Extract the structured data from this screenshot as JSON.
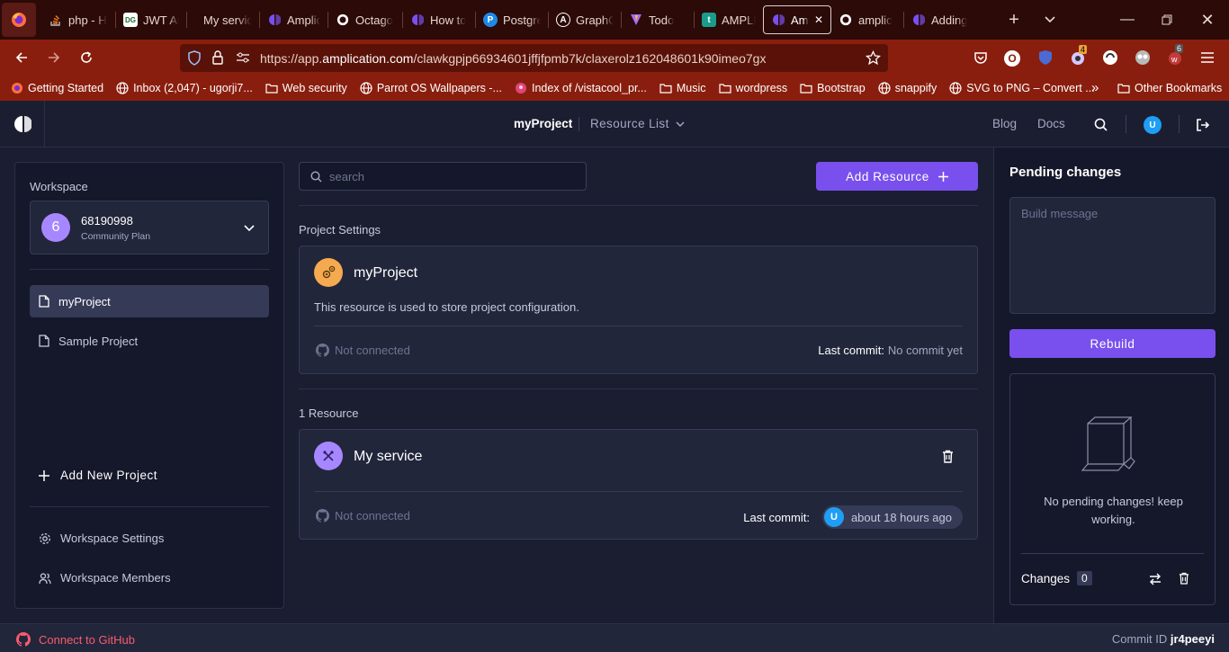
{
  "browser": {
    "tabs": [
      {
        "label": "php - H",
        "icon": "stackoverflow-icon",
        "color": "#f48024",
        "active": false
      },
      {
        "label": "JWT Au",
        "icon": "dg-icon",
        "color": "#3ba55c",
        "active": false
      },
      {
        "label": "My service",
        "icon": "",
        "color": "",
        "active": false
      },
      {
        "label": "Amplic",
        "icon": "amplication-icon",
        "color": "#7950ed",
        "active": false
      },
      {
        "label": "Octago",
        "icon": "github-icon",
        "color": "#ffffff",
        "active": false
      },
      {
        "label": "How to",
        "icon": "amplication-icon",
        "color": "#7950ed",
        "active": false
      },
      {
        "label": "Postgre",
        "icon": "postgres-icon",
        "color": "#1e88e5",
        "active": false
      },
      {
        "label": "GraphQ",
        "icon": "apollo-icon",
        "color": "#ffffff",
        "active": false
      },
      {
        "label": "Todo",
        "icon": "vite-icon",
        "color": "#ffc517",
        "active": false
      },
      {
        "label": "AMPLIC",
        "icon": "t-icon",
        "color": "#1a9c8c",
        "active": false
      },
      {
        "label": "Amp",
        "icon": "amplication-icon",
        "color": "#7950ed",
        "active": true
      },
      {
        "label": "amplic",
        "icon": "github-icon",
        "color": "#ffffff",
        "active": false
      },
      {
        "label": "Adding",
        "icon": "amplication-icon",
        "color": "#7950ed",
        "active": false
      }
    ],
    "url_prefix": "https://app.",
    "url_domain": "amplication.com",
    "url_path": "/clawkgpjp66934601jffjfpmb7k/claxerolz162048601k90imeo7gx",
    "toolbar_badges": {
      "ext_count": "4",
      "mail_count": "6"
    },
    "bookmarks": [
      {
        "label": "Getting Started",
        "icon": "firefox-icon"
      },
      {
        "label": "Inbox (2,047) - ugorji7...",
        "icon": "globe-icon"
      },
      {
        "label": "Web security",
        "icon": "folder-icon"
      },
      {
        "label": "Parrot OS Wallpapers -...",
        "icon": "globe-icon"
      },
      {
        "label": "Index of /vistacool_pr...",
        "icon": "page-icon"
      },
      {
        "label": "Music",
        "icon": "folder-icon"
      },
      {
        "label": "wordpress",
        "icon": "folder-icon"
      },
      {
        "label": "Bootstrap",
        "icon": "folder-icon"
      },
      {
        "label": "snappify",
        "icon": "globe-icon"
      },
      {
        "label": "SVG to PNG – Convert ...",
        "icon": "globe-icon"
      }
    ],
    "other_bookmarks": "Other Bookmarks"
  },
  "header": {
    "project": "myProject",
    "resource_list": "Resource List",
    "blog": "Blog",
    "docs": "Docs",
    "avatar": "U"
  },
  "workspace": {
    "title": "Workspace",
    "badge": "6",
    "name": "68190998",
    "plan": "Community Plan",
    "projects": [
      {
        "label": "myProject",
        "active": true
      },
      {
        "label": "Sample Project",
        "active": false
      }
    ],
    "add_project": "Add New Project",
    "settings": "Workspace Settings",
    "members": "Workspace Members"
  },
  "main": {
    "search_placeholder": "search",
    "add_resource": "Add Resource",
    "project_settings_label": "Project Settings",
    "project_card": {
      "title": "myProject",
      "description": "This resource is used to store project configuration.",
      "not_connected": "Not connected",
      "last_commit_label": "Last commit:",
      "last_commit_value": "No commit yet"
    },
    "resources_label": "1 Resource",
    "service_card": {
      "title": "My service",
      "not_connected": "Not connected",
      "last_commit_label": "Last commit:",
      "commit_avatar": "U",
      "commit_time": "about 18 hours ago"
    }
  },
  "pending": {
    "title": "Pending changes",
    "build_placeholder": "Build message",
    "rebuild": "Rebuild",
    "empty_text": "No pending changes! keep working.",
    "changes_label": "Changes",
    "changes_count": "0"
  },
  "footer": {
    "github": "Connect to GitHub",
    "commit_id_label": "Commit ID",
    "commit_id": "jr4peeyi"
  },
  "colors": {
    "accent": "#7950ed",
    "github_link": "#f85b6e",
    "avatar_blue": "#1e9ef4",
    "project_icon_bg": "#f6aa50"
  }
}
